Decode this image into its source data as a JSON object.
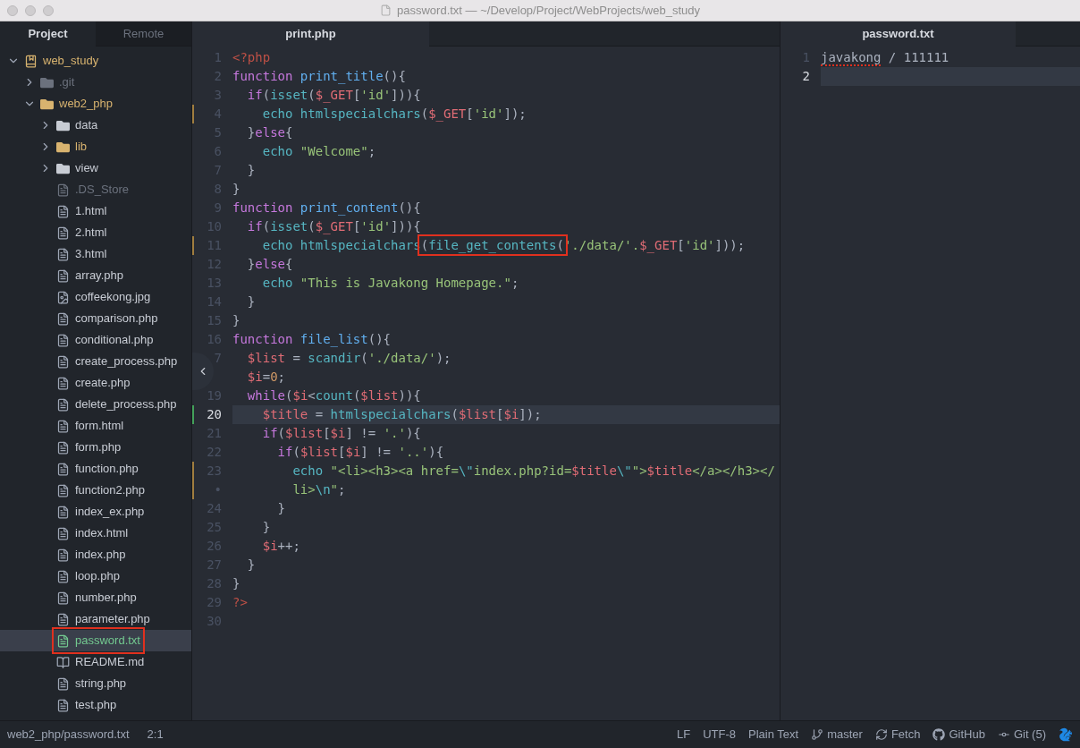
{
  "window": {
    "title": "password.txt — ~/Develop/Project/WebProjects/web_study"
  },
  "sidebar": {
    "tabs": [
      {
        "label": "Project",
        "selected": true
      },
      {
        "label": "Remote",
        "selected": false
      }
    ],
    "tree": [
      {
        "name": "web_study",
        "kind": "repo",
        "color": "#d8b36f",
        "expanded": true,
        "selected": false,
        "children": [
          {
            "name": ".git",
            "kind": "folder",
            "color": "#6b717d",
            "expanded": false,
            "selected": false
          },
          {
            "name": "web2_php",
            "kind": "folder",
            "color": "#d8b36f",
            "expanded": true,
            "selected": false,
            "children": [
              {
                "name": "data",
                "kind": "folder",
                "color": "#c8ccd4",
                "expanded": false,
                "selected": false
              },
              {
                "name": "lib",
                "kind": "folder",
                "color": "#d8b36f",
                "expanded": false,
                "selected": false
              },
              {
                "name": "view",
                "kind": "folder",
                "color": "#c8ccd4",
                "expanded": false,
                "selected": false
              },
              {
                "name": ".DS_Store",
                "kind": "file",
                "color": "#6b717d",
                "selected": false
              },
              {
                "name": "1.html",
                "kind": "file",
                "color": "#c8ccd4",
                "selected": false
              },
              {
                "name": "2.html",
                "kind": "file",
                "color": "#c8ccd4",
                "selected": false
              },
              {
                "name": "3.html",
                "kind": "file",
                "color": "#c8ccd4",
                "selected": false
              },
              {
                "name": "array.php",
                "kind": "file",
                "color": "#c8ccd4",
                "selected": false
              },
              {
                "name": "coffeekong.jpg",
                "kind": "image",
                "color": "#c8ccd4",
                "selected": false
              },
              {
                "name": "comparison.php",
                "kind": "file",
                "color": "#c8ccd4",
                "selected": false
              },
              {
                "name": "conditional.php",
                "kind": "file",
                "color": "#c8ccd4",
                "selected": false
              },
              {
                "name": "create_process.php",
                "kind": "file",
                "color": "#c8ccd4",
                "selected": false
              },
              {
                "name": "create.php",
                "kind": "file",
                "color": "#c8ccd4",
                "selected": false
              },
              {
                "name": "delete_process.php",
                "kind": "file",
                "color": "#c8ccd4",
                "selected": false
              },
              {
                "name": "form.html",
                "kind": "file",
                "color": "#c8ccd4",
                "selected": false
              },
              {
                "name": "form.php",
                "kind": "file",
                "color": "#c8ccd4",
                "selected": false
              },
              {
                "name": "function.php",
                "kind": "file",
                "color": "#c8ccd4",
                "selected": false
              },
              {
                "name": "function2.php",
                "kind": "file",
                "color": "#c8ccd4",
                "selected": false
              },
              {
                "name": "index_ex.php",
                "kind": "file",
                "color": "#c8ccd4",
                "selected": false
              },
              {
                "name": "index.html",
                "kind": "file",
                "color": "#c8ccd4",
                "selected": false
              },
              {
                "name": "index.php",
                "kind": "file",
                "color": "#c8ccd4",
                "selected": false
              },
              {
                "name": "loop.php",
                "kind": "file",
                "color": "#c8ccd4",
                "selected": false
              },
              {
                "name": "number.php",
                "kind": "file",
                "color": "#c8ccd4",
                "selected": false
              },
              {
                "name": "parameter.php",
                "kind": "file",
                "color": "#c8ccd4",
                "selected": false
              },
              {
                "name": "password.txt",
                "kind": "file",
                "color": "#73c990",
                "selected": true,
                "annotated": true
              },
              {
                "name": "README.md",
                "kind": "markdown",
                "color": "#c8ccd4",
                "selected": false
              },
              {
                "name": "string.php",
                "kind": "file",
                "color": "#c8ccd4",
                "selected": false
              },
              {
                "name": "test.php",
                "kind": "file",
                "color": "#c8ccd4",
                "selected": false
              }
            ]
          }
        ]
      }
    ]
  },
  "panes": [
    {
      "tabs": [
        {
          "label": "print.php",
          "selected": true
        }
      ],
      "lines": [
        {
          "number": "1",
          "selected": false,
          "tokens": [
            {
              "kind": "tag",
              "text": "<?php"
            }
          ]
        },
        {
          "number": "2",
          "selected": false,
          "tokens": [
            {
              "kind": "kw",
              "text": "function "
            },
            {
              "kind": "fn",
              "text": "print_title"
            },
            {
              "kind": "plain",
              "text": "(){"
            }
          ]
        },
        {
          "number": "3",
          "selected": false,
          "tokens": [
            {
              "kind": "kw",
              "text": "  if"
            },
            {
              "kind": "plain",
              "text": "("
            },
            {
              "kind": "sup",
              "text": "isset"
            },
            {
              "kind": "plain",
              "text": "("
            },
            {
              "kind": "var",
              "text": "$_GET"
            },
            {
              "kind": "plain",
              "text": "["
            },
            {
              "kind": "str",
              "text": "'id'"
            },
            {
              "kind": "plain",
              "text": "])){"
            }
          ]
        },
        {
          "number": "4",
          "color": "#a07d3f",
          "selected": false,
          "tokens": [
            {
              "kind": "sup",
              "text": "    echo "
            },
            {
              "kind": "sup",
              "text": "htmlspecialchars"
            },
            {
              "kind": "plain",
              "text": "("
            },
            {
              "kind": "var",
              "text": "$_GET"
            },
            {
              "kind": "plain",
              "text": "["
            },
            {
              "kind": "str",
              "text": "'id'"
            },
            {
              "kind": "plain",
              "text": "]);"
            }
          ]
        },
        {
          "number": "5",
          "selected": false,
          "tokens": [
            {
              "kind": "plain",
              "text": "  }"
            },
            {
              "kind": "kw",
              "text": "else"
            },
            {
              "kind": "plain",
              "text": "{"
            }
          ]
        },
        {
          "number": "6",
          "selected": false,
          "tokens": [
            {
              "kind": "sup",
              "text": "    echo "
            },
            {
              "kind": "str",
              "text": "\"Welcome\""
            },
            {
              "kind": "plain",
              "text": ";"
            }
          ]
        },
        {
          "number": "7",
          "selected": false,
          "tokens": [
            {
              "kind": "plain",
              "text": "  }"
            }
          ]
        },
        {
          "number": "8",
          "selected": false,
          "tokens": [
            {
              "kind": "plain",
              "text": "}"
            }
          ]
        },
        {
          "number": "9",
          "selected": false,
          "tokens": [
            {
              "kind": "kw",
              "text": "function "
            },
            {
              "kind": "fn",
              "text": "print_content"
            },
            {
              "kind": "plain",
              "text": "(){"
            }
          ]
        },
        {
          "number": "10",
          "selected": false,
          "tokens": [
            {
              "kind": "kw",
              "text": "  if"
            },
            {
              "kind": "plain",
              "text": "("
            },
            {
              "kind": "sup",
              "text": "isset"
            },
            {
              "kind": "plain",
              "text": "("
            },
            {
              "kind": "var",
              "text": "$_GET"
            },
            {
              "kind": "plain",
              "text": "["
            },
            {
              "kind": "str",
              "text": "'id'"
            },
            {
              "kind": "plain",
              "text": "])){"
            }
          ]
        },
        {
          "number": "11",
          "color": "#a07d3f",
          "selected": false,
          "tokens": [
            {
              "kind": "sup",
              "text": "    echo "
            },
            {
              "kind": "sup",
              "text": "htmlspecialchars"
            },
            {
              "kind": "group",
              "boxed": true,
              "tokens": [
                {
                  "kind": "plain",
                  "text": "("
                },
                {
                  "kind": "sup",
                  "text": "file_get_contents"
                },
                {
                  "kind": "plain",
                  "text": "("
                }
              ]
            },
            {
              "kind": "str",
              "text": "'./data/'."
            },
            {
              "kind": "var",
              "text": "$_GET"
            },
            {
              "kind": "plain",
              "text": "["
            },
            {
              "kind": "str",
              "text": "'id'"
            },
            {
              "kind": "plain",
              "text": "]));"
            }
          ]
        },
        {
          "number": "12",
          "selected": false,
          "tokens": [
            {
              "kind": "plain",
              "text": "  }"
            },
            {
              "kind": "kw",
              "text": "else"
            },
            {
              "kind": "plain",
              "text": "{"
            }
          ]
        },
        {
          "number": "13",
          "selected": false,
          "tokens": [
            {
              "kind": "sup",
              "text": "    echo "
            },
            {
              "kind": "str",
              "text": "\"This is Javakong Homepage.\""
            },
            {
              "kind": "plain",
              "text": ";"
            }
          ]
        },
        {
          "number": "14",
          "selected": false,
          "tokens": [
            {
              "kind": "plain",
              "text": "  }"
            }
          ]
        },
        {
          "number": "15",
          "selected": false,
          "tokens": [
            {
              "kind": "plain",
              "text": "}"
            }
          ]
        },
        {
          "number": "16",
          "selected": false,
          "tokens": [
            {
              "kind": "kw",
              "text": "function "
            },
            {
              "kind": "fn",
              "text": "file_list"
            },
            {
              "kind": "plain",
              "text": "(){"
            }
          ]
        },
        {
          "number": "7",
          "selected": false,
          "tokens": [
            {
              "kind": "var",
              "text": "  $list"
            },
            {
              "kind": "plain",
              "text": " = "
            },
            {
              "kind": "sup",
              "text": "scandir"
            },
            {
              "kind": "plain",
              "text": "("
            },
            {
              "kind": "str",
              "text": "'./data/'"
            },
            {
              "kind": "plain",
              "text": ");"
            }
          ]
        },
        {
          "selected": false,
          "tokens": [
            {
              "kind": "var",
              "text": "  $i"
            },
            {
              "kind": "plain",
              "text": "="
            },
            {
              "kind": "num",
              "text": "0"
            },
            {
              "kind": "plain",
              "text": ";"
            }
          ]
        },
        {
          "number": "19",
          "selected": false,
          "tokens": [
            {
              "kind": "kw",
              "text": "  while"
            },
            {
              "kind": "plain",
              "text": "("
            },
            {
              "kind": "var",
              "text": "$i"
            },
            {
              "kind": "plain",
              "text": "<"
            },
            {
              "kind": "sup",
              "text": "count"
            },
            {
              "kind": "plain",
              "text": "("
            },
            {
              "kind": "var",
              "text": "$list"
            },
            {
              "kind": "plain",
              "text": ")){"
            }
          ]
        },
        {
          "number": "20",
          "color": "#43a15a",
          "selected": true,
          "tokens": [
            {
              "kind": "var",
              "text": "    $title"
            },
            {
              "kind": "plain",
              "text": " = "
            },
            {
              "kind": "sup",
              "text": "htmlspecialchars"
            },
            {
              "kind": "plain",
              "text": "("
            },
            {
              "kind": "var",
              "text": "$list"
            },
            {
              "kind": "plain",
              "text": "["
            },
            {
              "kind": "var",
              "text": "$i"
            },
            {
              "kind": "plain",
              "text": "]);"
            }
          ]
        },
        {
          "number": "21",
          "selected": false,
          "tokens": [
            {
              "kind": "kw",
              "text": "    if"
            },
            {
              "kind": "plain",
              "text": "("
            },
            {
              "kind": "var",
              "text": "$list"
            },
            {
              "kind": "plain",
              "text": "["
            },
            {
              "kind": "var",
              "text": "$i"
            },
            {
              "kind": "plain",
              "text": "] != "
            },
            {
              "kind": "str",
              "text": "'.'"
            },
            {
              "kind": "plain",
              "text": "){"
            }
          ]
        },
        {
          "number": "22",
          "selected": false,
          "tokens": [
            {
              "kind": "kw",
              "text": "      if"
            },
            {
              "kind": "plain",
              "text": "("
            },
            {
              "kind": "var",
              "text": "$list"
            },
            {
              "kind": "plain",
              "text": "["
            },
            {
              "kind": "var",
              "text": "$i"
            },
            {
              "kind": "plain",
              "text": "] != "
            },
            {
              "kind": "str",
              "text": "'..'"
            },
            {
              "kind": "plain",
              "text": "){"
            }
          ]
        },
        {
          "number": "23",
          "color": "#a07d3f",
          "selected": false,
          "tokens": [
            {
              "kind": "sup",
              "text": "        echo "
            },
            {
              "kind": "str",
              "text": "\"<li><h3><a href="
            },
            {
              "kind": "esc",
              "text": "\\\""
            },
            {
              "kind": "str",
              "text": "index.php?id="
            },
            {
              "kind": "var",
              "text": "$title"
            },
            {
              "kind": "esc",
              "text": "\\\""
            },
            {
              "kind": "str",
              "text": "\">"
            },
            {
              "kind": "var",
              "text": "$title"
            },
            {
              "kind": "str",
              "text": "</a></h3></"
            }
          ]
        },
        {
          "number": "•",
          "color": "#a07d3f",
          "selected": false,
          "tokens": [
            {
              "kind": "str",
              "text": "        li>"
            },
            {
              "kind": "esc",
              "text": "\\n"
            },
            {
              "kind": "str",
              "text": "\""
            },
            {
              "kind": "plain",
              "text": ";"
            }
          ]
        },
        {
          "number": "24",
          "selected": false,
          "tokens": [
            {
              "kind": "plain",
              "text": "      }"
            }
          ]
        },
        {
          "number": "25",
          "selected": false,
          "tokens": [
            {
              "kind": "plain",
              "text": "    }"
            }
          ]
        },
        {
          "number": "26",
          "selected": false,
          "tokens": [
            {
              "kind": "var",
              "text": "    $i"
            },
            {
              "kind": "plain",
              "text": "++;"
            }
          ]
        },
        {
          "number": "27",
          "selected": false,
          "tokens": [
            {
              "kind": "plain",
              "text": "  }"
            }
          ]
        },
        {
          "number": "28",
          "selected": false,
          "tokens": [
            {
              "kind": "plain",
              "text": "}"
            }
          ]
        },
        {
          "number": "29",
          "selected": false,
          "tokens": [
            {
              "kind": "tag",
              "text": "?>"
            }
          ]
        },
        {
          "number": "30",
          "selected": false
        }
      ]
    },
    {
      "tabs": [
        {
          "label": "password.txt",
          "selected": true
        }
      ],
      "lines": [
        {
          "number": "1",
          "selected": false,
          "tokens": [
            {
              "kind": "plain",
              "text": "javakong",
              "misspelled": true
            },
            {
              "kind": "plain",
              "text": " / 111111"
            }
          ]
        },
        {
          "number": "2",
          "selected": true
        }
      ]
    }
  ],
  "status_bar": {
    "path": "web2_php/password.txt",
    "cursor": "2:1",
    "items": [
      {
        "kind": "text",
        "text": "LF"
      },
      {
        "kind": "text",
        "text": "UTF-8"
      },
      {
        "kind": "text",
        "text": "Plain Text"
      },
      {
        "kind": "branch",
        "text": "master"
      },
      {
        "kind": "fetch",
        "text": "Fetch"
      },
      {
        "kind": "github",
        "text": "GitHub"
      },
      {
        "kind": "commit",
        "text": "Git (5)"
      },
      {
        "kind": "squirrel"
      }
    ]
  }
}
